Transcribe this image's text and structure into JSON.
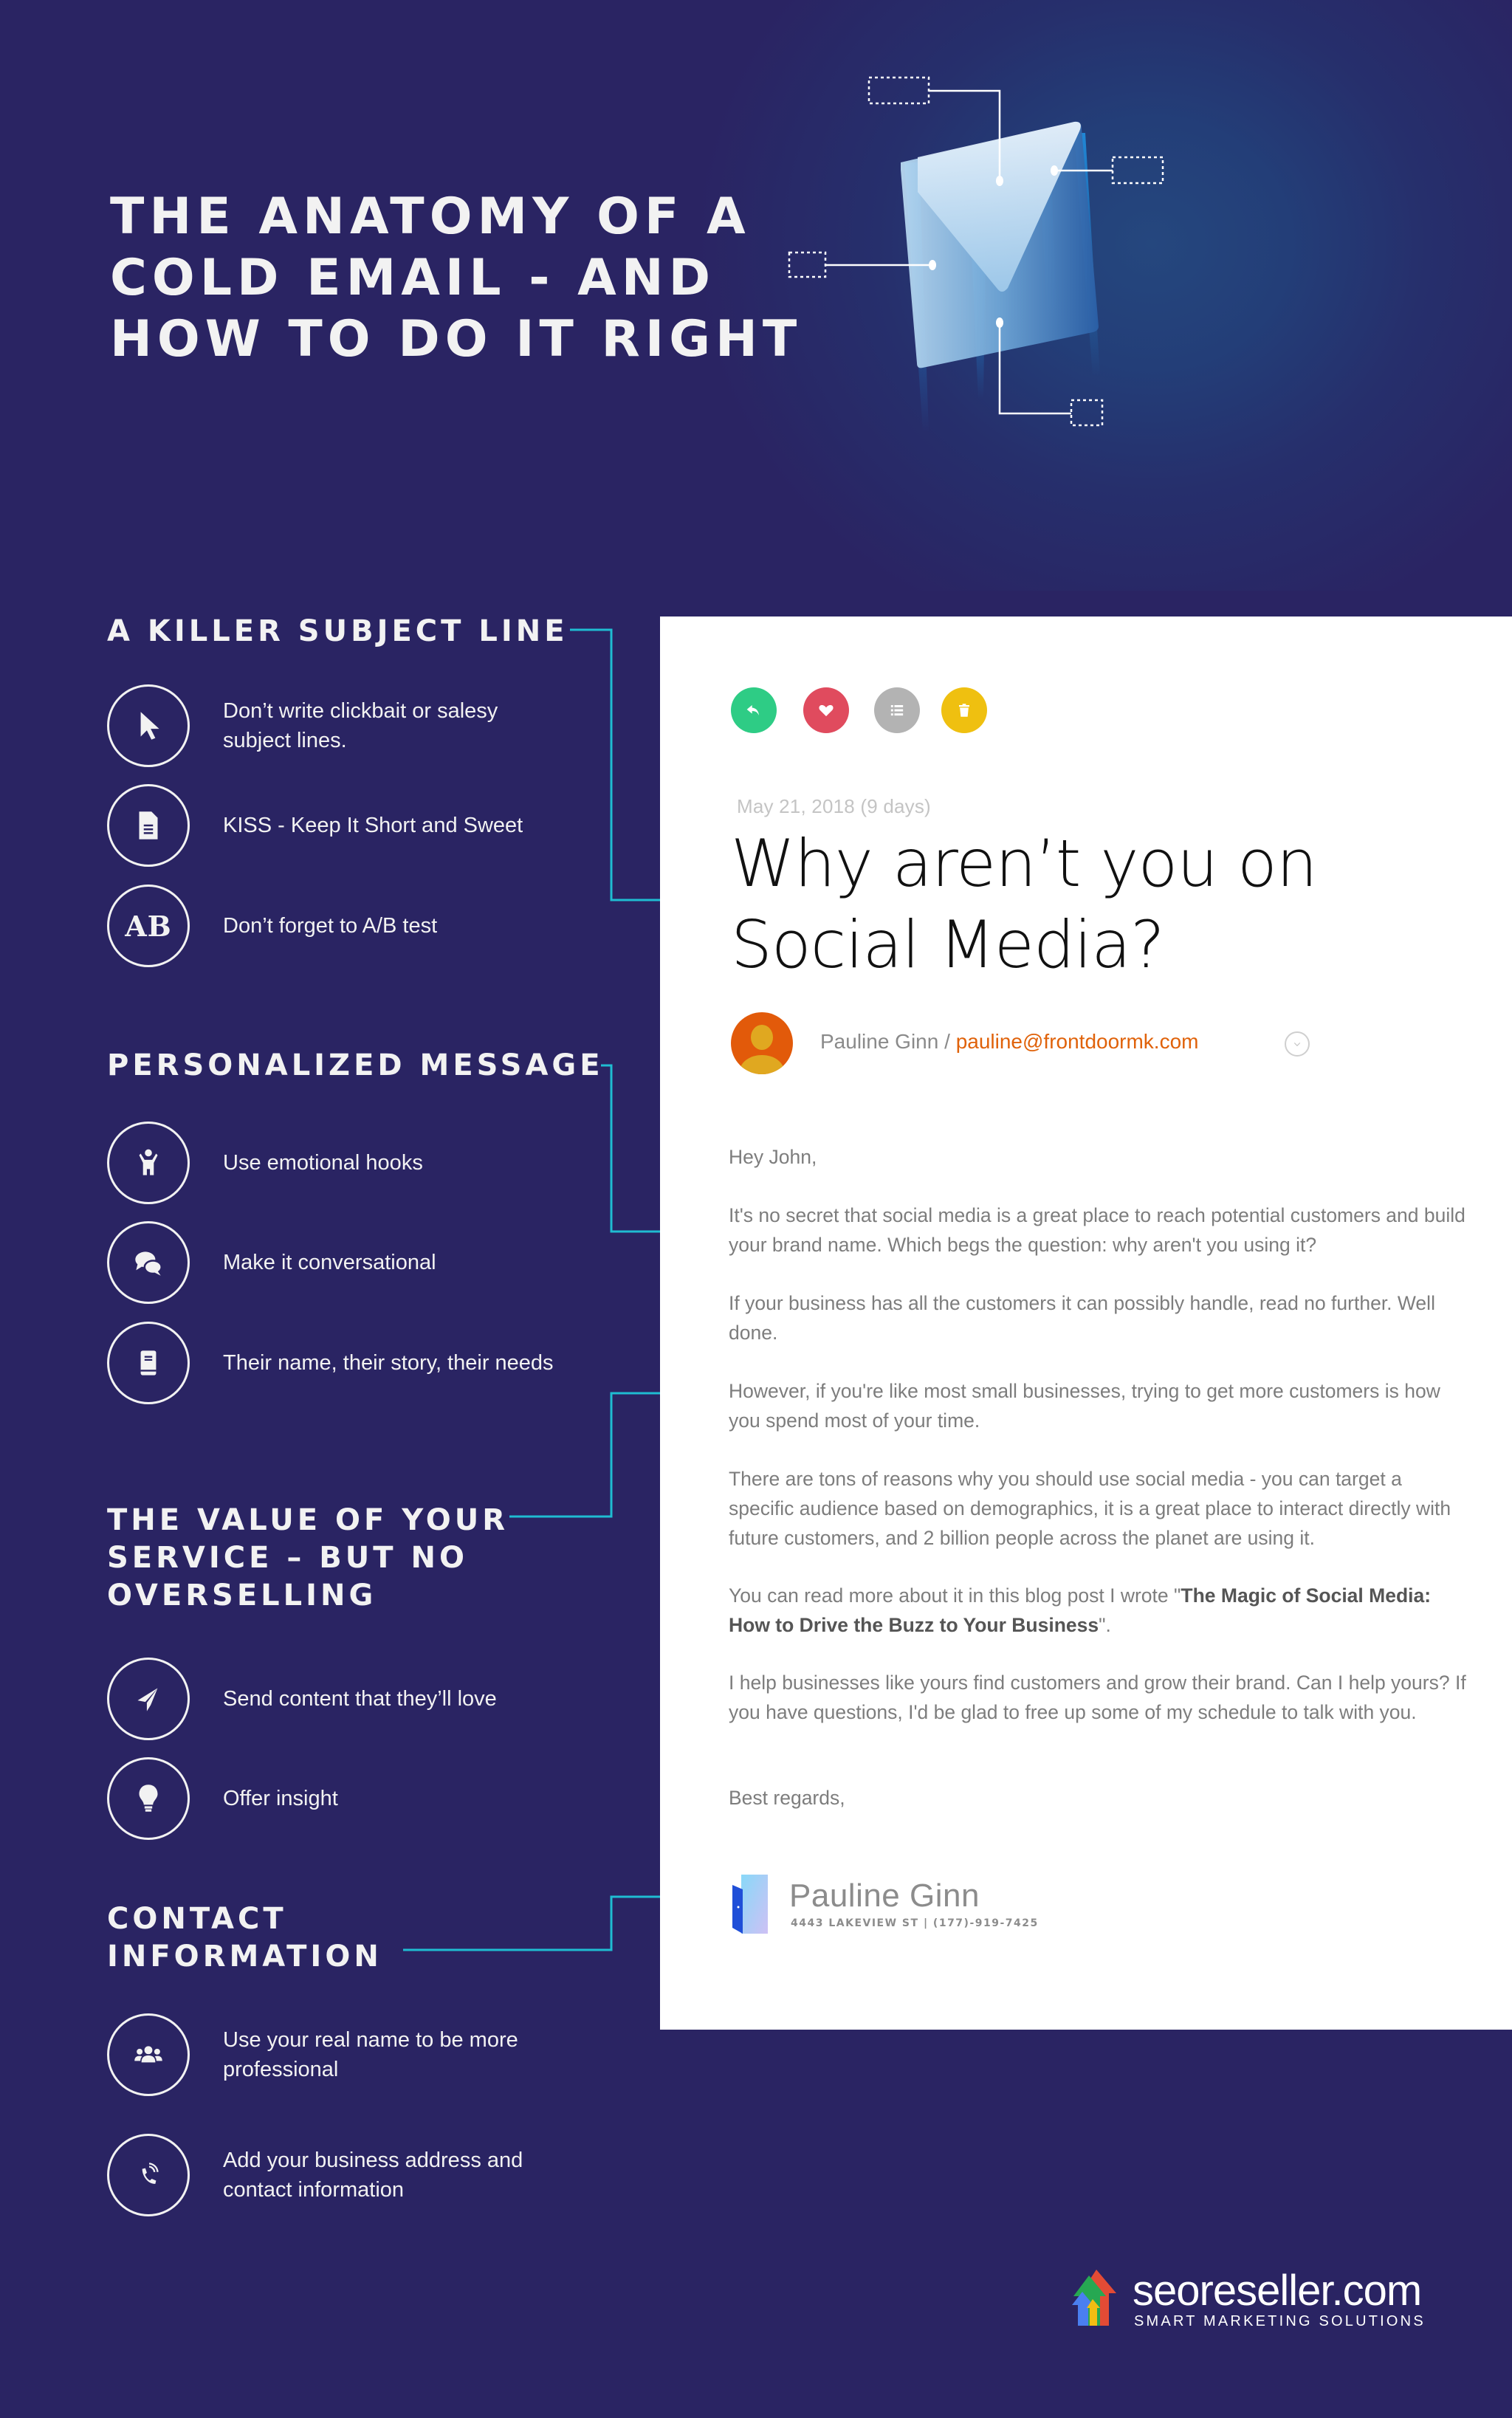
{
  "hero": {
    "title_lines": [
      "THE ANATOMY OF A",
      "COLD EMAIL - AND",
      "HOW TO DO IT RIGHT"
    ],
    "illustration": "envelope-icon"
  },
  "sections": [
    {
      "title_lines": [
        "A KILLER SUBJECT LINE"
      ],
      "tips": [
        {
          "icon": "cursor-icon",
          "text": "Don’t write clickbait or salesy subject lines."
        },
        {
          "icon": "document-icon",
          "text": "KISS - Keep It Short and Sweet"
        },
        {
          "icon": "ab-test-icon",
          "icon_text": "AB",
          "text": "Don’t forget to A/B test"
        }
      ]
    },
    {
      "title_lines": [
        "PERSONALIZED MESSAGE"
      ],
      "tips": [
        {
          "icon": "person-cheering-icon",
          "text": "Use emotional hooks"
        },
        {
          "icon": "chat-bubbles-icon",
          "text": "Make it conversational"
        },
        {
          "icon": "book-icon",
          "text": "Their name, their story, their needs"
        }
      ]
    },
    {
      "title_lines": [
        "THE VALUE OF YOUR",
        "SERVICE – BUT NO",
        "OVERSELLING"
      ],
      "tips": [
        {
          "icon": "paper-plane-icon",
          "text": "Send content that they’ll love"
        },
        {
          "icon": "lightbulb-icon",
          "text": "Offer insight"
        }
      ]
    },
    {
      "title_lines": [
        "CONTACT",
        "INFORMATION"
      ],
      "tips": [
        {
          "icon": "group-icon",
          "text": "Use your real name to be more professional"
        },
        {
          "icon": "phone-ringing-icon",
          "text": "Add your business address and contact information"
        }
      ]
    }
  ],
  "email": {
    "actions": [
      {
        "name": "reply",
        "icon": "reply-icon",
        "color": "#2ecc85"
      },
      {
        "name": "favorite",
        "icon": "heart-icon",
        "color": "#e04b5e"
      },
      {
        "name": "list",
        "icon": "list-icon",
        "color": "#b3b3b3"
      },
      {
        "name": "delete",
        "icon": "trash-icon",
        "color": "#efc010"
      }
    ],
    "date": "May 21, 2018 (9 days)",
    "subject_lines": [
      "Why aren’t you on",
      "Social Media?"
    ],
    "sender_name": "Pauline Ginn",
    "sender_separator": " / ",
    "sender_email": "pauline@frontdoormk.com",
    "greeting": "Hey John,",
    "paragraphs": [
      "It's no secret that social media is a great place to reach potential customers and build your brand name. Which begs the question: why aren't you using it?",
      "If your business has all the customers it can possibly handle, read no further. Well done.",
      "However, if you're like most small businesses, trying to get more customers is how you spend most of your time.",
      "There are tons of reasons why you should use social media - you can target a specific audience based on demographics, it is a great place to interact directly with future customers, and 2 billion people across the planet are using it."
    ],
    "blog_paragraph": {
      "before": "You can read more about it in this blog post I wrote \"",
      "link": "The Magic of Social Media: How to Drive the Buzz to Your Business",
      "after": "\"."
    },
    "closing_paragraph": "I help businesses like yours find customers and grow their brand. Can I help yours? If you have questions, I'd be glad to free up some of my schedule to talk with you.",
    "signoff": "Best regards,",
    "signature": {
      "name": "Pauline Ginn",
      "address_line": "4443 LAKEVIEW ST | (177)-919-7425"
    }
  },
  "footer": {
    "brand_name": "seoreseller.com",
    "tagline": "SMART MARKETING SOLUTIONS"
  },
  "colors": {
    "background": "#2a2463",
    "connector": "#1fbcd2",
    "accent_orange": "#e0620a"
  }
}
